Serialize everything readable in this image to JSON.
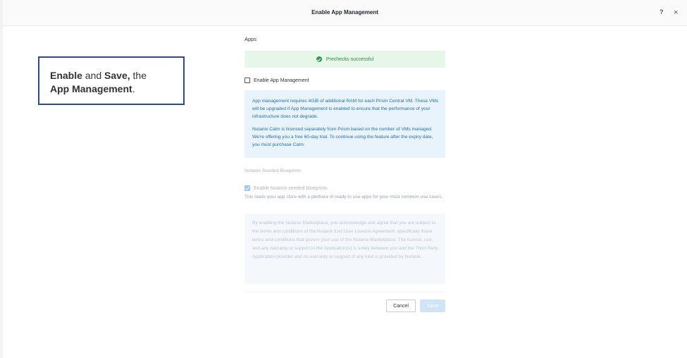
{
  "header": {
    "title": "Enable App Management",
    "help_icon": "?",
    "close_icon": "×"
  },
  "callout": {
    "part1_bold": "Enable",
    "part2": " and ",
    "part3_bold": "Save,",
    "part4": " the",
    "part5_bold": "App Management",
    "part6": "."
  },
  "apps": {
    "section_label": "Apps",
    "precheck_text": "Prechecks successful",
    "enable_checkbox_label": "Enable App Management",
    "enable_checked": false,
    "info_paragraph_1": "App management requires 4GiB of additional RAM for each Prism Central VM. These VMs will be upgraded if App Management is enabled to ensure that the performance of your infrastructure does not degrade.",
    "info_paragraph_2": "Nutanix Calm is licensed separately from Prism based on the number of VMs managed. We're offering you a free 60-day trial. To continue using the feature after the expiry date, you must purchase Calm."
  },
  "blueprints": {
    "section_label": "Nutanix Seeded Blueprints",
    "checkbox_label": "Enable Nutanix seeded blueprints",
    "checked": true,
    "description": "This loads your app store with a plethora of ready to use apps for your most common use cases.",
    "license_text": "By enabling the Nutanix Marketplace, you acknowledge and agree that you are subject to the terms and conditions of the Nutanix End User License Agreement, specifically those terms and conditions that govern your use of the Nutanix Marketplace. The license, use, and any warranty or support in the Application(s) is solely between you and the Third Party Application provider and no warranty or support of any kind is provided by Nutanix."
  },
  "footer": {
    "cancel_label": "Cancel",
    "save_label": "Save"
  },
  "colors": {
    "accent": "#1f6fb5",
    "success": "#2e9e4a",
    "callout_border": "#2e4a8c"
  }
}
